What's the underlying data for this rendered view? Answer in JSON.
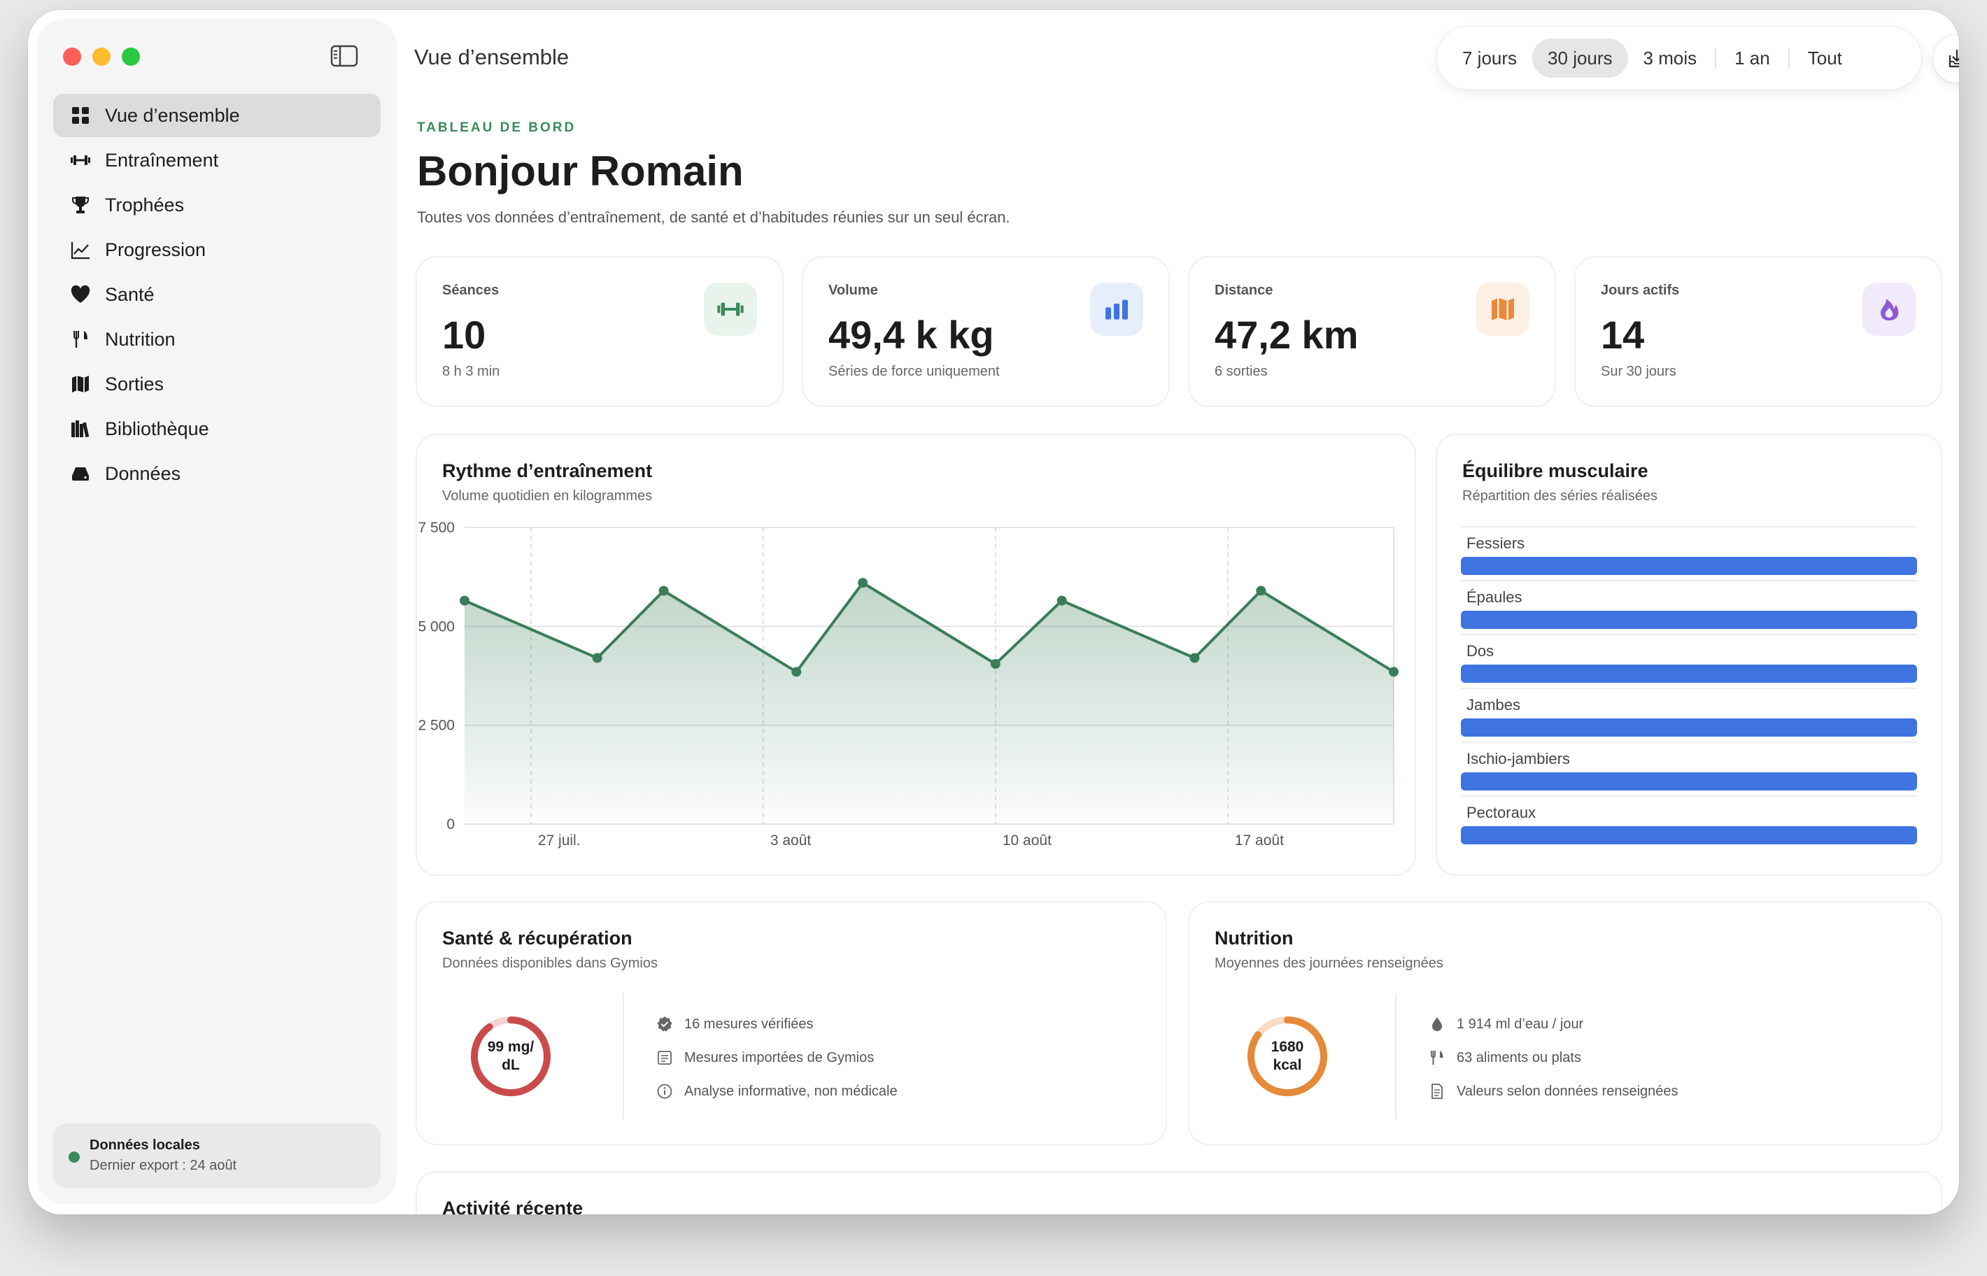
{
  "sidebar": {
    "items": [
      {
        "label": "Vue d’ensemble",
        "icon": "grid-icon",
        "active": true
      },
      {
        "label": "Entraînement",
        "icon": "dumbbell-icon"
      },
      {
        "label": "Trophées",
        "icon": "trophy-icon"
      },
      {
        "label": "Progression",
        "icon": "chart-line-icon"
      },
      {
        "label": "Santé",
        "icon": "heart-icon"
      },
      {
        "label": "Nutrition",
        "icon": "fork-knife-icon"
      },
      {
        "label": "Sorties",
        "icon": "map-icon"
      },
      {
        "label": "Bibliothèque",
        "icon": "books-icon"
      },
      {
        "label": "Données",
        "icon": "drive-icon"
      }
    ],
    "status": {
      "title": "Données locales",
      "subtitle": "Dernier export : 24 août",
      "color": "#3a8a5a"
    }
  },
  "topbar": {
    "title": "Vue d’ensemble",
    "ranges": [
      "7 jours",
      "30 jours",
      "3 mois",
      "1 an",
      "Tout"
    ],
    "active_range": "30 jours"
  },
  "header": {
    "eyebrow": "TABLEAU DE BORD",
    "greeting": "Bonjour Romain",
    "subtitle": "Toutes vos données d’entraînement, de santé et d’habitudes réunies sur un seul écran."
  },
  "stats": [
    {
      "label": "Séances",
      "value": "10",
      "sub": "8 h 3 min",
      "icon": "dumbbell-icon",
      "color": "#3a8a5a",
      "bg": "#e8f3ec"
    },
    {
      "label": "Volume",
      "value": "49,4 k kg",
      "sub": "Séries de force uniquement",
      "icon": "bar-chart-icon",
      "color": "#3f74e0",
      "bg": "#e7eefb"
    },
    {
      "label": "Distance",
      "value": "47,2 km",
      "sub": "6 sorties",
      "icon": "map-icon",
      "color": "#e98a3a",
      "bg": "#fcefe3"
    },
    {
      "label": "Jours actifs",
      "value": "14",
      "sub": "Sur 30 jours",
      "icon": "flame-icon",
      "color": "#8e5ad6",
      "bg": "#f1eafb"
    }
  ],
  "rhythm": {
    "title": "Rythme d’entraînement",
    "subtitle": "Volume quotidien en kilogrammes"
  },
  "chart_data": {
    "type": "area",
    "x": [
      "25 juil.",
      "29 juil.",
      "31 juil.",
      "4 août",
      "6 août",
      "10 août",
      "12 août",
      "16 août",
      "18 août",
      "22 août"
    ],
    "series": [
      {
        "values": [
          5650,
          4200,
          5900,
          3850,
          6100,
          4050,
          5650,
          4200,
          5900,
          3850
        ]
      }
    ],
    "x_ticks": [
      "27 juil.",
      "3 août",
      "10 août",
      "17 août"
    ],
    "y_ticks": [
      "0",
      "2 500",
      "5 000",
      "7 500"
    ],
    "ylim": [
      0,
      7500
    ],
    "color": "#3a7d58",
    "grid": true
  },
  "muscles": {
    "title": "Équilibre musculaire",
    "subtitle": "Répartition des séries réalisées",
    "items": [
      {
        "label": "Fessiers",
        "share": 1.0
      },
      {
        "label": "Épaules",
        "share": 1.0
      },
      {
        "label": "Dos",
        "share": 1.0
      },
      {
        "label": "Jambes",
        "share": 1.0
      },
      {
        "label": "Ischio-jambiers",
        "share": 1.0
      },
      {
        "label": "Pectoraux",
        "share": 1.0
      }
    ],
    "bar_color": "#3f74e0"
  },
  "health": {
    "title": "Santé & récupération",
    "subtitle": "Données disponibles dans Gymios",
    "ring_line1": "99 mg/",
    "ring_line2": "dL",
    "ring_fraction": 0.9,
    "ring_color": "#c94b4b",
    "info": [
      {
        "text": "16 mesures vérifiées",
        "icon": "check-badge-icon"
      },
      {
        "text": "Mesures importées de Gymios",
        "icon": "list-icon"
      },
      {
        "text": "Analyse informative, non médicale",
        "icon": "info-icon"
      }
    ]
  },
  "nutrition": {
    "title": "Nutrition",
    "subtitle": "Moyennes des journées renseignées",
    "ring_line1": "1680",
    "ring_line2": "kcal",
    "ring_fraction": 0.85,
    "ring_color": "#e58a3a",
    "info": [
      {
        "text": "1 914 ml d’eau / jour",
        "icon": "drop-icon"
      },
      {
        "text": "63 aliments ou plats",
        "icon": "fork-knife-icon"
      },
      {
        "text": "Valeurs selon données renseignées",
        "icon": "document-icon"
      }
    ]
  },
  "recent": {
    "title": "Activité récente"
  }
}
